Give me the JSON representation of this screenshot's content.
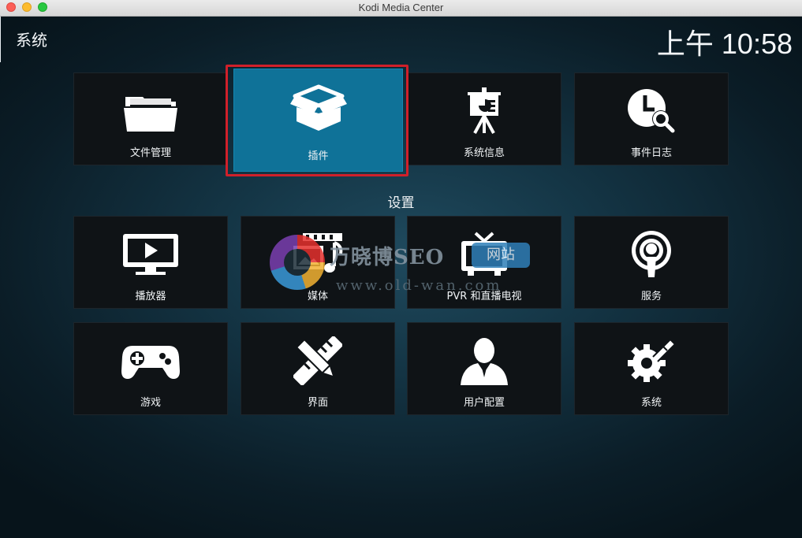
{
  "window": {
    "title": "Kodi Media Center"
  },
  "header": {
    "title": "系统",
    "clock": "上午 10:58"
  },
  "top_row": [
    {
      "label": "文件管理",
      "icon": "folder-icon"
    },
    {
      "label": "插件",
      "icon": "package-icon",
      "selected": true
    },
    {
      "label": "系统信息",
      "icon": "presentation-icon"
    },
    {
      "label": "事件日志",
      "icon": "clock-search-icon"
    }
  ],
  "section": {
    "title": "设置"
  },
  "settings": [
    {
      "label": "播放器",
      "icon": "play-screen-icon"
    },
    {
      "label": "媒体",
      "icon": "media-icon"
    },
    {
      "label": "PVR 和直播电视",
      "icon": "tv-icon"
    },
    {
      "label": "服务",
      "icon": "broadcast-icon"
    },
    {
      "label": "游戏",
      "icon": "gamepad-icon"
    },
    {
      "label": "界面",
      "icon": "pencil-ruler-icon"
    },
    {
      "label": "用户配置",
      "icon": "user-icon"
    },
    {
      "label": "系统",
      "icon": "gears-tools-icon"
    }
  ],
  "watermark": {
    "brand": "万晓博SEO",
    "badge": "网站",
    "url": "www.old-wan.com"
  },
  "colors": {
    "selected_tile": "#0f7298",
    "focus_ring": "#d0202a",
    "tile_bg": "#0f1316"
  }
}
